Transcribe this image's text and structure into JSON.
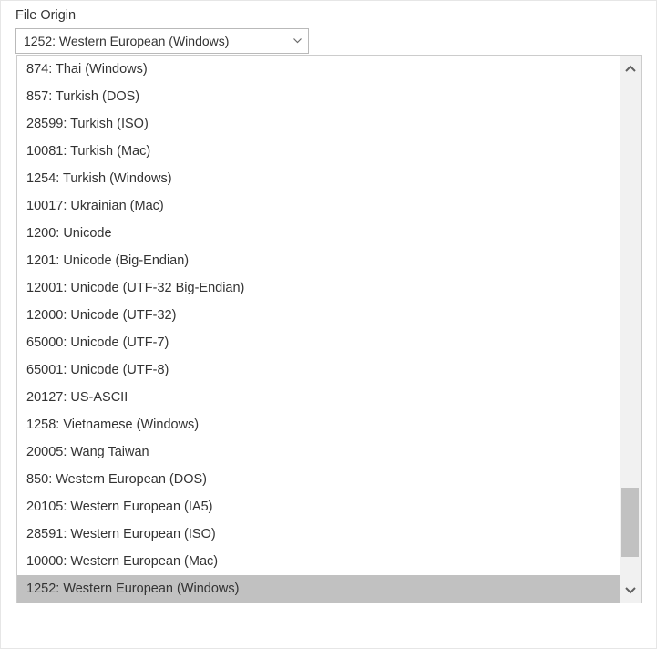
{
  "fieldLabel": "File Origin",
  "combo": {
    "selectedLabel": "1252: Western European (Windows)"
  },
  "options": [
    "874: Thai (Windows)",
    "857: Turkish (DOS)",
    "28599: Turkish (ISO)",
    "10081: Turkish (Mac)",
    "1254: Turkish (Windows)",
    "10017: Ukrainian (Mac)",
    "1200: Unicode",
    "1201: Unicode (Big-Endian)",
    "12001: Unicode (UTF-32 Big-Endian)",
    "12000: Unicode (UTF-32)",
    "65000: Unicode (UTF-7)",
    "65001: Unicode (UTF-8)",
    "20127: US-ASCII",
    "1258: Vietnamese (Windows)",
    "20005: Wang Taiwan",
    "850: Western European (DOS)",
    "20105: Western European (IA5)",
    "28591: Western European (ISO)",
    "10000: Western European (Mac)",
    "1252: Western European (Windows)"
  ],
  "selectedIndex": 19,
  "scrollbar": {
    "thumbTopPct": 82,
    "thumbHeightPct": 14
  }
}
